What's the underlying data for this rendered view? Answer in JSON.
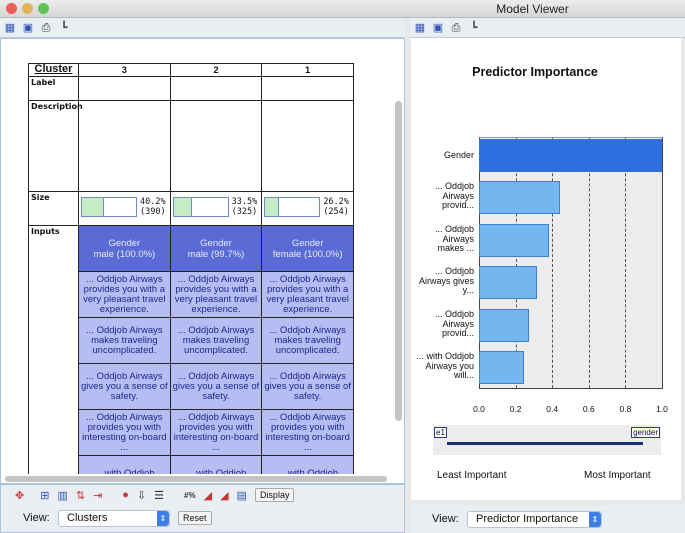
{
  "window": {
    "title": "Model Viewer"
  },
  "left": {
    "table": {
      "header": "Cluster",
      "clusters": [
        "3",
        "2",
        "1"
      ],
      "row_labels": {
        "label": "Label",
        "description": "Description",
        "size": "Size",
        "inputs": "Inputs"
      },
      "sizes": [
        {
          "pct": "40.2%",
          "n": "(390)",
          "fraction": 0.402
        },
        {
          "pct": "33.5%",
          "n": "(325)",
          "fraction": 0.335
        },
        {
          "pct": "26.2%",
          "n": "(254)",
          "fraction": 0.262
        }
      ],
      "gender": [
        {
          "name": "Gender",
          "value": "male (100.0%)"
        },
        {
          "name": "Gender",
          "value": "male (99.7%)"
        },
        {
          "name": "Gender",
          "value": "female (100.0%)"
        }
      ],
      "inputs": [
        "... Oddjob Airways provides you with a very pleasant travel experience.",
        "... Oddjob Airways makes traveling uncomplicated.",
        "... Oddjob Airways gives you a sense of safety.",
        "... Oddjob Airways provides you with interesting on-board ...",
        "... with Oddjob Airways you will..."
      ]
    },
    "display_button": "Display",
    "view_label": "View:",
    "view_value": "Clusters",
    "reset_button": "Reset"
  },
  "right": {
    "view_label": "View:",
    "view_value": "Predictor Importance",
    "slider": {
      "min_label": "e1",
      "max_label": "gender",
      "least": "Least Important",
      "most": "Most Important"
    }
  },
  "chart_data": {
    "type": "bar",
    "orientation": "horizontal",
    "title": "Predictor Importance",
    "categories": [
      "Gender",
      "... Oddjob Airways provid...",
      "... Oddjob Airways makes ...",
      "... Oddjob Airways gives y...",
      "... Oddjob Airways provid...",
      "... with Oddjob Airways you will..."
    ],
    "values": [
      1.0,
      0.44,
      0.385,
      0.315,
      0.275,
      0.245
    ],
    "xlim": [
      0,
      1
    ],
    "xticks": [
      "0.0",
      "0.2",
      "0.4",
      "0.6",
      "0.8",
      "1.0"
    ],
    "colors": {
      "top": "#2f6fe0",
      "other": "#74b6ee"
    }
  }
}
